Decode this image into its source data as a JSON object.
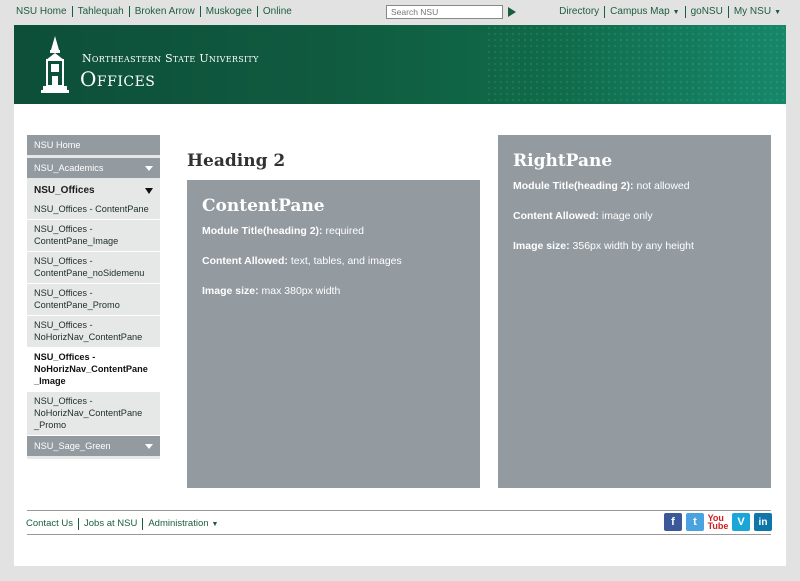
{
  "topbar": {
    "links": [
      "NSU Home",
      "Tahlequah",
      "Broken Arrow",
      "Muskogee",
      "Online"
    ],
    "search_placeholder": "Search NSU",
    "right_links": [
      "Directory",
      "Campus Map",
      "goNSU",
      "My NSU"
    ]
  },
  "banner": {
    "university": "Northeastern State University",
    "title": "Offices"
  },
  "sidebar": {
    "items": [
      {
        "label": "NSU Home",
        "type": "head"
      },
      {
        "label": "NSU_Academics",
        "type": "head-arrow"
      },
      {
        "label": "NSU_Offices",
        "type": "open"
      },
      {
        "label": "NSU_Offices - ContentPane"
      },
      {
        "label": "NSU_Offices -\nContentPane_Image"
      },
      {
        "label": "NSU_Offices -\nContentPane_noSidemenu"
      },
      {
        "label": "NSU_Offices -\nContentPane_Promo"
      },
      {
        "label": "NSU_Offices -\nNoHorizNav_ContentPane"
      },
      {
        "label": "NSU_Offices -\nNoHorizNav_ContentPane\n_Image",
        "active": true
      },
      {
        "label": "NSU_Offices -\nNoHorizNav_ContentPane\n_Promo"
      },
      {
        "label": "NSU_Sage_Green",
        "type": "head-arrow"
      }
    ]
  },
  "content": {
    "heading": "Heading 2",
    "content_pane": {
      "title": "ContentPane",
      "lines": [
        {
          "label": "Module Title(heading 2):",
          "value": " required"
        },
        {
          "label": "Content Allowed:",
          "value": " text, tables, and images"
        },
        {
          "label": "Image size:",
          "value": " max 380px width"
        }
      ]
    },
    "right_pane": {
      "title": "RightPane",
      "lines": [
        {
          "label": "Module Title(heading 2):",
          "value": " not allowed"
        },
        {
          "label": "Content Allowed:",
          "value": " image only"
        },
        {
          "label": "Image size:",
          "value": " 356px width by any height"
        }
      ]
    }
  },
  "footer": {
    "links": [
      "Contact Us",
      "Jobs at NSU",
      "Administration"
    ],
    "social": [
      {
        "name": "facebook-icon",
        "glyph": "f"
      },
      {
        "name": "twitter-icon",
        "glyph": "t"
      },
      {
        "name": "youtube-icon",
        "glyph": "You\nTube"
      },
      {
        "name": "vimeo-icon",
        "glyph": "V"
      },
      {
        "name": "linkedin-icon",
        "glyph": "in"
      }
    ]
  }
}
